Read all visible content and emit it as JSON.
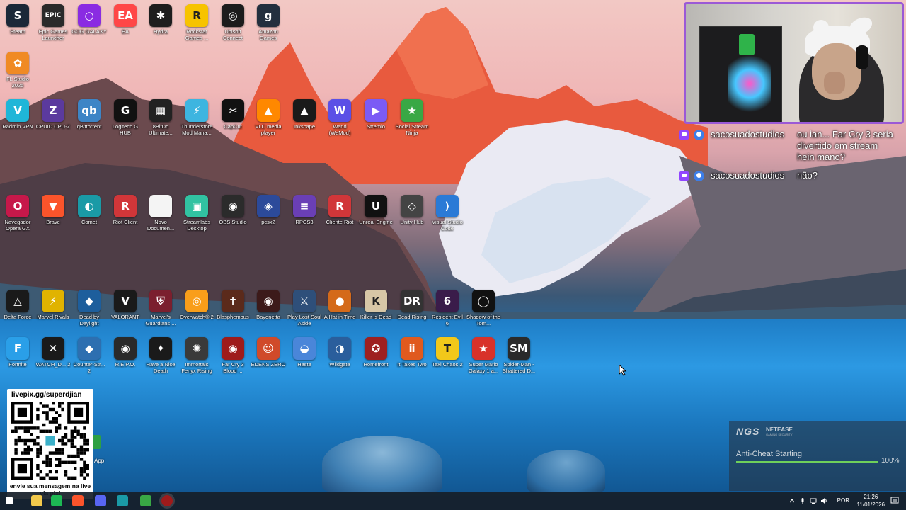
{
  "desktop": {
    "rows": [
      {
        "items": [
          {
            "label": "Steam",
            "icon": "steam-icon",
            "glyph": "S",
            "color": "#1b2838"
          },
          {
            "label": "Epic Games Launcher",
            "icon": "epic-games-icon",
            "glyph": "EPIC",
            "color": "#2a2a2a"
          },
          {
            "label": "GOG GALAXY",
            "icon": "gog-galaxy-icon",
            "glyph": "○",
            "color": "#8a2be2"
          },
          {
            "label": "EA",
            "icon": "ea-icon",
            "glyph": "EA",
            "color": "#ff4747"
          },
          {
            "label": "Hydra",
            "icon": "hydra-icon",
            "glyph": "✱",
            "color": "#1e1e1e"
          },
          {
            "label": "Rockstar Games ...",
            "icon": "rockstar-icon",
            "glyph": "R",
            "color": "#f7c300"
          },
          {
            "label": "Ubisoft Connect",
            "icon": "ubisoft-icon",
            "glyph": "◎",
            "color": "#1c1c1c"
          },
          {
            "label": "Amazon Games",
            "icon": "amazon-games-icon",
            "glyph": "g",
            "color": "#232f3e"
          }
        ]
      },
      {
        "items": [
          {
            "label": "FL Studio 2025",
            "icon": "fl-studio-icon",
            "glyph": "✿",
            "color": "#f08a24"
          }
        ]
      },
      {
        "items": [
          {
            "label": "Radmin VPN",
            "icon": "radmin-vpn-icon",
            "glyph": "V",
            "color": "#1fb6d8"
          },
          {
            "label": "CPUID CPU-Z",
            "icon": "cpu-z-icon",
            "glyph": "Z",
            "color": "#5b3a9e"
          },
          {
            "label": "qBittorrent",
            "icon": "qbittorrent-icon",
            "glyph": "qb",
            "color": "#3d85c6"
          },
          {
            "label": "Logitech G HUB",
            "icon": "logitech-icon",
            "glyph": "G",
            "color": "#111111"
          },
          {
            "label": "8BitDo Ultimate...",
            "icon": "8bitdo-icon",
            "glyph": "▦",
            "color": "#222222"
          },
          {
            "label": "Thunderstore Mod Mana...",
            "icon": "thunderstore-icon",
            "glyph": "⚡",
            "color": "#3db5e0"
          },
          {
            "label": "CapCut",
            "icon": "capcut-icon",
            "glyph": "✂",
            "color": "#111111"
          },
          {
            "label": "VLC media player",
            "icon": "vlc-icon",
            "glyph": "▲",
            "color": "#ff8800"
          },
          {
            "label": "Inkscape",
            "icon": "inkscape-icon",
            "glyph": "▲",
            "color": "#1a1a1a"
          },
          {
            "label": "Wand (WeMod)",
            "icon": "wemod-icon",
            "glyph": "W",
            "color": "#5b4fe6"
          },
          {
            "label": "Stremio",
            "icon": "stremio-icon",
            "glyph": "▶",
            "color": "#7b5bf5"
          },
          {
            "label": "Social Stream Ninja",
            "icon": "social-stream-icon",
            "glyph": "★",
            "color": "#39a845"
          }
        ]
      },
      {
        "items": [
          {
            "label": "Navegador Opera GX",
            "icon": "opera-gx-icon",
            "glyph": "O",
            "color": "#c6184a"
          },
          {
            "label": "Brave",
            "icon": "brave-icon",
            "glyph": "▼",
            "color": "#fb542b"
          },
          {
            "label": "Comet",
            "icon": "comet-icon",
            "glyph": "◐",
            "color": "#1a9aa6"
          },
          {
            "label": "Riot Client",
            "icon": "riot-client-icon",
            "glyph": "R",
            "color": "#d13639"
          },
          {
            "label": "Novo Documen...",
            "icon": "document-icon",
            "glyph": "",
            "color": "#f4f4f4"
          },
          {
            "label": "Streamlabs Desktop",
            "icon": "streamlabs-icon",
            "glyph": "▣",
            "color": "#31c3a2"
          },
          {
            "label": "OBS Studio",
            "icon": "obs-icon",
            "glyph": "◉",
            "color": "#2b2b2b"
          },
          {
            "label": "pcsx2",
            "icon": "pcsx2-icon",
            "glyph": "◈",
            "color": "#2c4a9a"
          },
          {
            "label": "RPCS3",
            "icon": "rpcs3-icon",
            "glyph": "≡",
            "color": "#6a3fb5"
          },
          {
            "label": "Cliente Riot",
            "icon": "riot-client-2-icon",
            "glyph": "R",
            "color": "#d13639"
          },
          {
            "label": "Unreal Engine",
            "icon": "unreal-engine-icon",
            "glyph": "U",
            "color": "#111111"
          },
          {
            "label": "Unity Hub",
            "icon": "unity-hub-icon",
            "glyph": "◇",
            "color": "#444444"
          },
          {
            "label": "Visual Studio Code",
            "icon": "vscode-icon",
            "glyph": "⟩",
            "color": "#2a7ad6"
          }
        ]
      },
      {
        "items": [
          {
            "label": "Delta Force",
            "icon": "delta-force-icon",
            "glyph": "△",
            "color": "#1a1a1a"
          },
          {
            "label": "Marvel Rivals",
            "icon": "marvel-rivals-icon",
            "glyph": "⚡",
            "color": "#e0b300"
          },
          {
            "label": "Dead by Daylight",
            "icon": "dead-by-daylight-icon",
            "glyph": "◆",
            "color": "#1d5e9c"
          },
          {
            "label": "VALORANT",
            "icon": "valorant-icon",
            "glyph": "V",
            "color": "#1a1a1a"
          },
          {
            "label": "Marvel's Guardians ...",
            "icon": "guardians-icon",
            "glyph": "⛨",
            "color": "#7b1f2e"
          },
          {
            "label": "Overwatch® 2",
            "icon": "overwatch-icon",
            "glyph": "◎",
            "color": "#f99e1a"
          },
          {
            "label": "Blasphemous",
            "icon": "blasphemous-icon",
            "glyph": "✝",
            "color": "#5b2a1b"
          },
          {
            "label": "Bayonetta",
            "icon": "bayonetta-icon",
            "glyph": "◉",
            "color": "#3c1a1a"
          },
          {
            "label": "Play Lost Soul Aside",
            "icon": "lost-soul-aside-icon",
            "glyph": "⚔",
            "color": "#2e4f7a"
          },
          {
            "label": "A Hat in Time",
            "icon": "a-hat-in-time-icon",
            "glyph": "●",
            "color": "#d46a1a"
          },
          {
            "label": "Killer is Dead",
            "icon": "killer-is-dead-icon",
            "glyph": "K",
            "color": "#d8c7a6"
          },
          {
            "label": "Dead Rising",
            "icon": "dead-rising-icon",
            "glyph": "DR",
            "color": "#333333"
          },
          {
            "label": "Resident Evil 6",
            "icon": "resident-evil-icon",
            "glyph": "6",
            "color": "#3a1c4a"
          },
          {
            "label": "Shadow of the Tom...",
            "icon": "shadow-tomb-raider-icon",
            "glyph": "◯",
            "color": "#111111"
          }
        ]
      },
      {
        "items": [
          {
            "label": "Fortnite",
            "icon": "fortnite-icon",
            "glyph": "F",
            "color": "#2a9fe8"
          },
          {
            "label": "WATCH_D... 2",
            "icon": "watch-dogs-icon",
            "glyph": "✕",
            "color": "#1a1a1a"
          },
          {
            "label": "Counter-Str... 2",
            "icon": "counter-strike-icon",
            "glyph": "◆",
            "color": "#2d6fb0"
          },
          {
            "label": "R.E.P.O.",
            "icon": "repo-icon",
            "glyph": "◉",
            "color": "#2a2a2a"
          },
          {
            "label": "Have a Nice Death",
            "icon": "have-a-nice-death-icon",
            "glyph": "✦",
            "color": "#1a1a1a"
          },
          {
            "label": "Immortals Fenyx Rising",
            "icon": "immortals-icon",
            "glyph": "✺",
            "color": "#3a3a3a"
          },
          {
            "label": "Far Cry 3 Blood ...",
            "icon": "far-cry-icon",
            "glyph": "◉",
            "color": "#9e1b1b"
          },
          {
            "label": "EDENS ZERO",
            "icon": "edens-zero-icon",
            "glyph": "☺",
            "color": "#d04a2a"
          },
          {
            "label": "Haste",
            "icon": "haste-icon",
            "glyph": "◒",
            "color": "#4a86d9"
          },
          {
            "label": "Wildgate",
            "icon": "wildgate-icon",
            "glyph": "◑",
            "color": "#2a5e9c"
          },
          {
            "label": "Homefront",
            "icon": "homefront-icon",
            "glyph": "✪",
            "color": "#9e2020"
          },
          {
            "label": "It Takes Two",
            "icon": "it-takes-two-icon",
            "glyph": "ⅱ",
            "color": "#e05a1e"
          },
          {
            "label": "Taxi Chaos 2",
            "icon": "taxi-chaos-icon",
            "glyph": "T",
            "color": "#f2c81a"
          },
          {
            "label": "Super Mario Galaxy 1 a...",
            "icon": "mario-galaxy-icon",
            "glyph": "★",
            "color": "#d8322a"
          },
          {
            "label": "Spider-Man - Shattered D...",
            "icon": "spider-man-icon",
            "glyph": "SM",
            "color": "#2a2a2a"
          }
        ]
      }
    ]
  },
  "overlay": {
    "chat": [
      {
        "user": "sacosuadostudios",
        "text": "ou ian... Far Cry 3 seria\ndivertido em stream\nhein mano?"
      },
      {
        "user": "sacosuadostudios",
        "text": "não?"
      }
    ],
    "qr": {
      "top_text": "livepix.gg/superdjian",
      "bottom_text": "envie sua mensagem na live via pix!"
    },
    "behind_label": "App"
  },
  "anticheat": {
    "logo": "NGS",
    "brand": "NETEASE",
    "sub": "GAMING SECURITY",
    "status": "Anti-Cheat Starting",
    "progress": 100,
    "progress_label": "100%"
  },
  "taskbar": {
    "language": "POR",
    "time": "21:26",
    "date": "11/01/2026",
    "pinned": [
      {
        "icon": "start-icon",
        "color": "#ffffff"
      },
      {
        "icon": "file-explorer-icon",
        "color": "#f2c94c"
      },
      {
        "icon": "spotify-icon",
        "color": "#1db954"
      },
      {
        "icon": "brave-taskbar-icon",
        "color": "#fb542b"
      },
      {
        "icon": "discord-icon",
        "color": "#5865f2"
      },
      {
        "icon": "comet-taskbar-icon",
        "color": "#1a9aa6"
      },
      {
        "icon": "social-stream-taskbar-icon",
        "color": "#39a845"
      },
      {
        "icon": "far-cry-taskbar-icon",
        "color": "#9e1b1b"
      }
    ]
  }
}
